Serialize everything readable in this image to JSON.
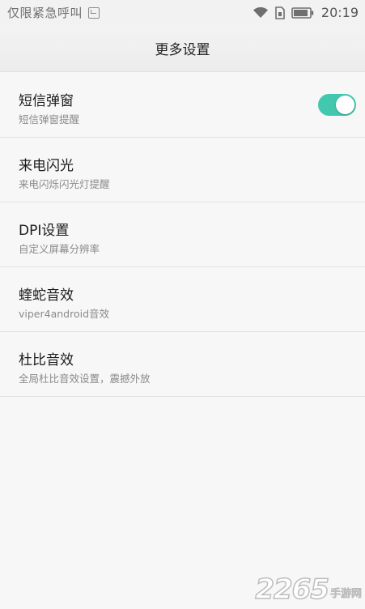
{
  "status_bar": {
    "carrier": "仅限紧急呼叫",
    "time": "20:19"
  },
  "header": {
    "title": "更多设置"
  },
  "settings": [
    {
      "title": "短信弹窗",
      "subtitle": "短信弹窗提醒",
      "toggle": true,
      "toggle_on": true
    },
    {
      "title": "来电闪光",
      "subtitle": "来电闪烁闪光灯提醒"
    },
    {
      "title": "DPI设置",
      "subtitle": "自定义屏幕分辨率"
    },
    {
      "title": "蝰蛇音效",
      "subtitle": "viper4android音效"
    },
    {
      "title": "杜比音效",
      "subtitle": "全局杜比音效设置，震撼外放"
    }
  ],
  "watermark": {
    "number": "2265",
    "text": "手游网"
  },
  "colors": {
    "accent": "#42c8ae",
    "background": "#f7f7f7",
    "divider": "#e1e1e1"
  },
  "icons": [
    "notification-icon",
    "wifi-icon",
    "sim-icon",
    "battery-icon"
  ]
}
